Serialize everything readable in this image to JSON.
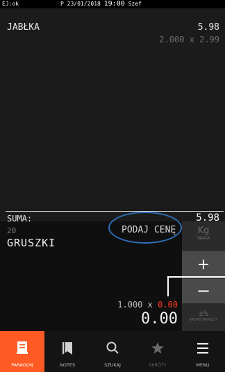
{
  "status_bar": {
    "left": "EJ:ok",
    "prefix": "P",
    "date": "23/01/2018",
    "time": "19:00",
    "user": "Szef"
  },
  "receipt": {
    "item": {
      "name": "JABŁKA",
      "price": "5.98",
      "detail": "2.000 x 2.99"
    },
    "sum_label": "SUMA:",
    "sum_value": "5.98"
  },
  "entry": {
    "quantity": "20",
    "product": "GRUSZKI",
    "prompt": "PODAJ CENĘ",
    "calc_qty": "1.000 x",
    "calc_price": "0.00",
    "total": "0.00"
  },
  "side_buttons": {
    "kg": "Kg",
    "kg_sub": "WAGA",
    "plus": "+",
    "minus": "−",
    "discount": "±%",
    "discount_sub": "RABAT/NARZUT"
  },
  "tabs": [
    {
      "label": "PARAGON",
      "icon": "receipt-icon"
    },
    {
      "label": "NOTES",
      "icon": "notes-icon"
    },
    {
      "label": "SZUKAJ",
      "icon": "search-icon"
    },
    {
      "label": "SKRÓTY",
      "icon": "star-icon"
    },
    {
      "label": "MENU",
      "icon": "menu-icon"
    }
  ],
  "colors": {
    "accent": "#ff5a24",
    "highlight": "#2f6fb7",
    "price_red": "#ff3b1f"
  }
}
